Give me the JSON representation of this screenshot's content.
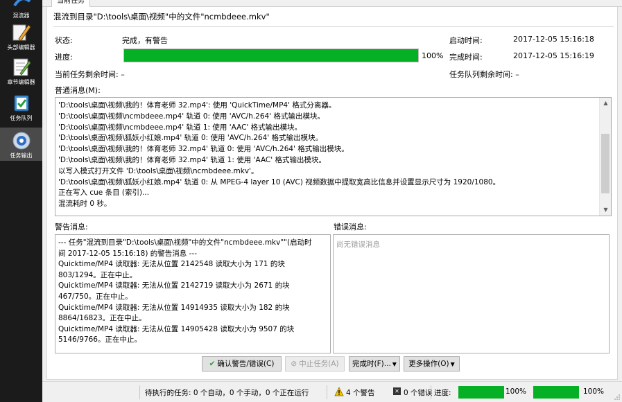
{
  "sidebar": {
    "items": [
      {
        "label": "混流器",
        "icon": "mixer-icon"
      },
      {
        "label": "头部编辑器",
        "icon": "header-editor-icon"
      },
      {
        "label": "章节编辑器",
        "icon": "chapter-editor-icon"
      },
      {
        "label": "任务队列",
        "icon": "job-queue-icon"
      },
      {
        "label": "任务输出",
        "icon": "job-output-icon",
        "active": true
      }
    ]
  },
  "tab": {
    "current_label": "当前任务"
  },
  "job": {
    "title": "混流到目录\"D:\\tools\\桌面\\视频\"中的文件\"ncmbdeee.mkv\"",
    "status_label": "状态:",
    "status_value": "完成，有警告",
    "progress_label": "进度:",
    "progress_value": "100%",
    "progress_fraction": 1.0,
    "start_label": "启动时间:",
    "start_value": "2017-12-05 15:16:18",
    "finish_label": "完成时间:",
    "finish_value": "2017-12-05 15:16:19",
    "remaining_label": "当前任务剩余时间: –",
    "queue_remaining_label": "任务队列剩余时间: –"
  },
  "messages": {
    "label": "普通消息(M):",
    "lines": [
      "'D:\\tools\\桌面\\视频\\我的！体育老师 32.mp4': 使用 'QuickTime/MP4' 格式分离器。",
      "'D:\\tools\\桌面\\视频\\ncmbdeee.mp4' 轨道 0: 使用 'AVC/h.264' 格式输出模块。",
      "'D:\\tools\\桌面\\视频\\ncmbdeee.mp4' 轨道 1: 使用 'AAC' 格式输出模块。",
      "'D:\\tools\\桌面\\视频\\狐妖小红娘.mp4' 轨道 0: 使用 'AVC/h.264' 格式输出模块。",
      "'D:\\tools\\桌面\\视频\\我的！体育老师 32.mp4' 轨道 0: 使用 'AVC/h.264' 格式输出模块。",
      "'D:\\tools\\桌面\\视频\\我的！体育老师 32.mp4' 轨道 1: 使用 'AAC' 格式输出模块。",
      "以写入模式打开文件 'D:\\tools\\桌面\\视频\\ncmbdeee.mkv'。",
      "'D:\\tools\\桌面\\视频\\狐妖小红娘.mp4' 轨道 0: 从 MPEG-4 layer 10 (AVC) 视频数据中提取宽高比信息并设置显示尺寸为 1920/1080。",
      "正在写入 cue 条目 (索引)...",
      "混流耗时 0 秒。"
    ]
  },
  "warnings": {
    "label": "警告消息:",
    "lines": [
      "--- 任务\"混流到目录\"D:\\tools\\桌面\\视频\"中的文件\"ncmbdeee.mkv\"\"(启动时间 2017-12-05 15:16:18) 的警告消息 ---",
      "Quicktime/MP4 读取器: 无法从位置 2142548 读取大小为 171 的块 803/1294。正在中止。",
      "Quicktime/MP4 读取器: 无法从位置 2142719 读取大小为 2671 的块 467/750。正在中止。",
      "Quicktime/MP4 读取器: 无法从位置 14914935 读取大小为 182 的块 8864/16823。正在中止。",
      "Quicktime/MP4 读取器: 无法从位置 14905428 读取大小为 9507 的块 5146/9766。正在中止。"
    ]
  },
  "errors": {
    "label": "错误消息:",
    "placeholder": "尚无错误消息"
  },
  "buttons": {
    "acknowledge": "确认警告/错误(C)",
    "abort": "中止任务(A)",
    "when_done": "完成时(F)...",
    "more_actions": "更多操作(O)"
  },
  "statusbar": {
    "pending_jobs": "待执行的任务: 0 个自动，0 个手动，0 个正在运行",
    "warnings": "4 个警告",
    "errors": "0 个错误",
    "progress_label": "进度:",
    "progress_value_1": "100%",
    "progress_value_2": "100%",
    "progress_fraction_1": 1.0,
    "progress_fraction_2": 1.0
  },
  "colors": {
    "progress_green": "#06b025",
    "sidebar_bg": "#1b1b1b",
    "warning_yellow": "#f5c400"
  }
}
